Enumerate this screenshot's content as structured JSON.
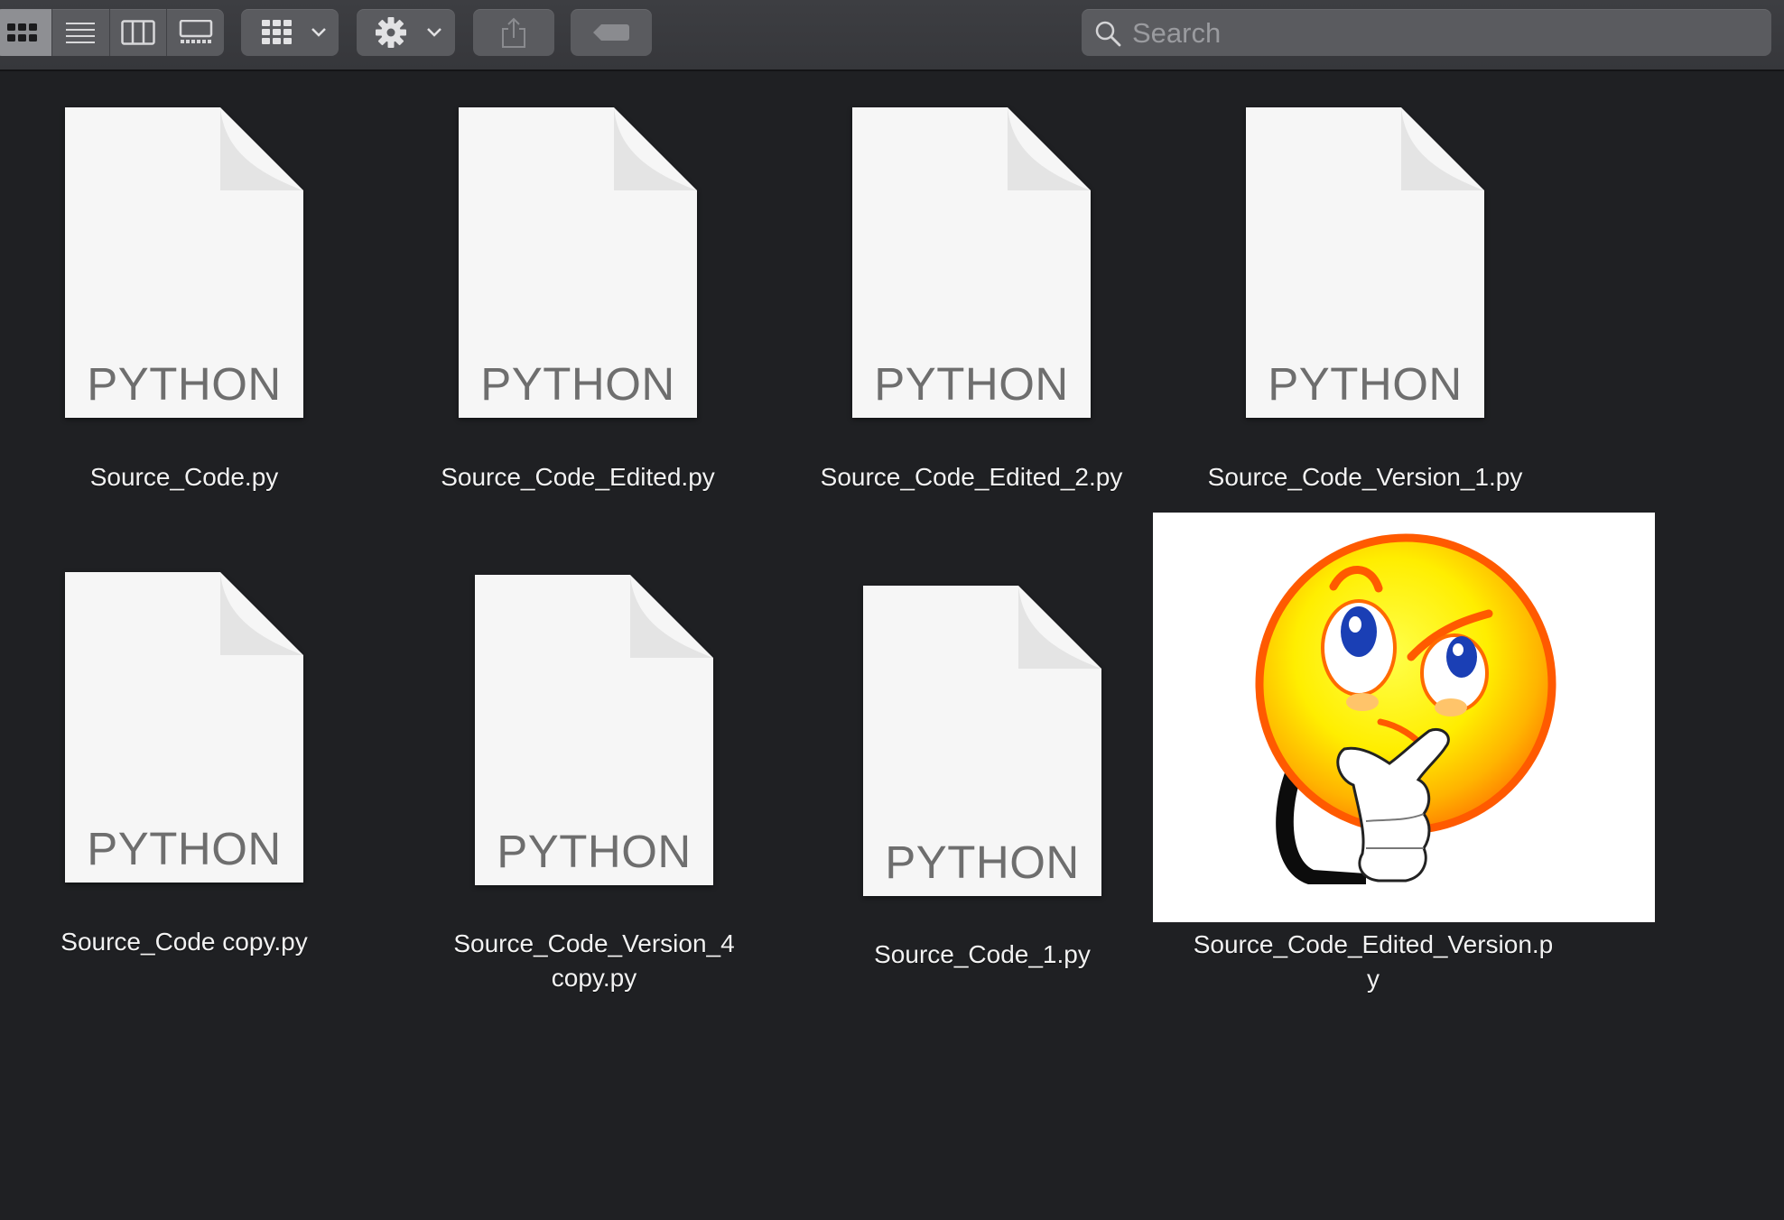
{
  "toolbar": {
    "view_modes": [
      "icon-view",
      "list-view",
      "column-view",
      "gallery-view"
    ],
    "active_view": "icon-view",
    "group_menu_icon": "group-grid-icon",
    "action_menu_icon": "gear-icon",
    "share_icon": "share-icon",
    "tags_icon": "tag-icon"
  },
  "search": {
    "placeholder": "Search",
    "value": ""
  },
  "files": [
    {
      "name": "Source_Code.py",
      "kind": "PYTHON"
    },
    {
      "name": "Source_Code_Edited.py",
      "kind": "PYTHON"
    },
    {
      "name": "Source_Code_Edited_2.py",
      "kind": "PYTHON"
    },
    {
      "name": "Source_Code_Version_1.py",
      "kind": "PYTHON"
    },
    {
      "name": "Source_Code copy.py",
      "kind": "PYTHON"
    },
    {
      "name": "Source_Code_Version_4\ncopy.py",
      "kind": "PYTHON"
    },
    {
      "name": "Source_Code_1.py",
      "kind": "PYTHON"
    },
    {
      "name": "Source_Code_Edited_Version.p\ny",
      "thumbnail": "thinking-smiley-image"
    }
  ],
  "colors": {
    "window_background": "#1f2023",
    "toolbar": "#3d3e42",
    "button": "#5a5b5f",
    "active_button": "#8e8f93",
    "doc_label": "#6e6e6e",
    "filename": "#f2f2f2"
  }
}
